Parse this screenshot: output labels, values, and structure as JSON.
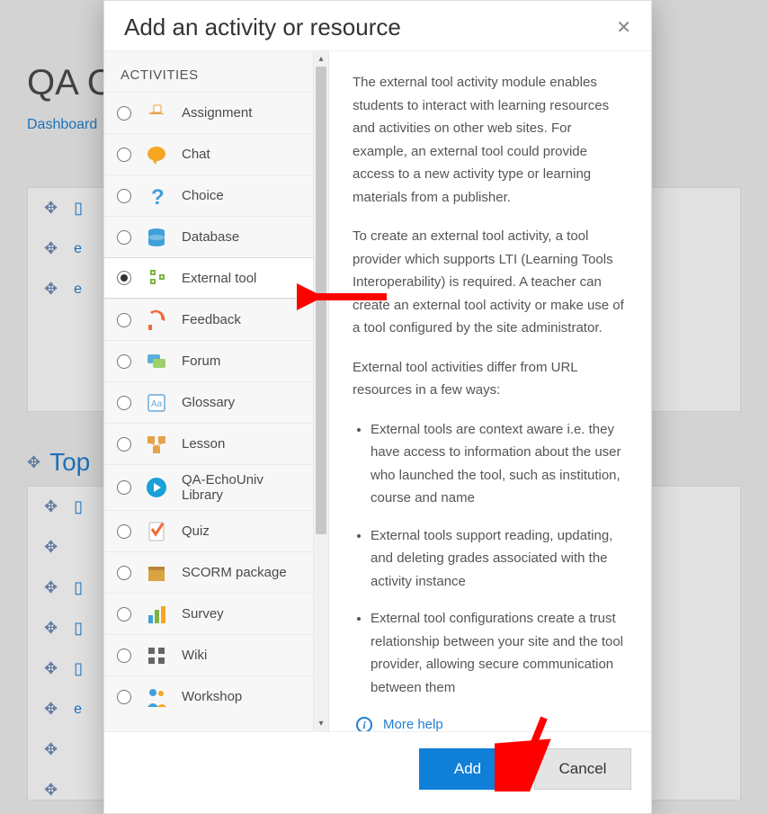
{
  "bg": {
    "title": "QA C",
    "breadcrumb": "Dashboard",
    "topic": "Top"
  },
  "modal": {
    "title": "Add an activity or resource",
    "section_heading": "ACTIVITIES",
    "activities": [
      {
        "label": "Assignment",
        "icon": "assignment",
        "selected": false
      },
      {
        "label": "Chat",
        "icon": "chat",
        "selected": false
      },
      {
        "label": "Choice",
        "icon": "choice",
        "selected": false
      },
      {
        "label": "Database",
        "icon": "database",
        "selected": false
      },
      {
        "label": "External tool",
        "icon": "external-tool",
        "selected": true
      },
      {
        "label": "Feedback",
        "icon": "feedback",
        "selected": false
      },
      {
        "label": "Forum",
        "icon": "forum",
        "selected": false
      },
      {
        "label": "Glossary",
        "icon": "glossary",
        "selected": false
      },
      {
        "label": "Lesson",
        "icon": "lesson",
        "selected": false
      },
      {
        "label": "QA-EchoUniv Library",
        "icon": "library",
        "selected": false
      },
      {
        "label": "Quiz",
        "icon": "quiz",
        "selected": false
      },
      {
        "label": "SCORM package",
        "icon": "scorm",
        "selected": false
      },
      {
        "label": "Survey",
        "icon": "survey",
        "selected": false
      },
      {
        "label": "Wiki",
        "icon": "wiki",
        "selected": false
      },
      {
        "label": "Workshop",
        "icon": "workshop",
        "selected": false
      }
    ],
    "description": {
      "p1": "The external tool activity module enables students to interact with learning resources and activities on other web sites. For example, an external tool could provide access to a new activity type or learning materials from a publisher.",
      "p2": "To create an external tool activity, a tool provider which supports LTI (Learning Tools Interoperability) is required. A teacher can create an external tool activity or make use of a tool configured by the site administrator.",
      "p3": "External tool activities differ from URL resources in a few ways:",
      "bullets": [
        "External tools are context aware i.e. they have access to information about the user who launched the tool, such as institution, course and name",
        "External tools support reading, updating, and deleting grades associated with the activity instance",
        "External tool configurations create a trust relationship between your site and the tool provider, allowing secure communication between them"
      ],
      "more_help": "More help"
    },
    "buttons": {
      "add": "Add",
      "cancel": "Cancel"
    }
  },
  "icon_colors": {
    "assignment": "#e6a24a",
    "chat": "#f5a623",
    "choice": "#3fa0d8",
    "database": "#3fa0d8",
    "external-tool": "#7cb342",
    "feedback": "#f26a3a",
    "forum": "#5fb0d8",
    "glossary": "#6aa8d8",
    "lesson": "#e6a24a",
    "library": "#1aa0d8",
    "quiz": "#f26a3a",
    "scorm": "#d9a441",
    "survey": "#7cb342",
    "wiki": "#666666",
    "workshop": "#3fa0d8"
  }
}
